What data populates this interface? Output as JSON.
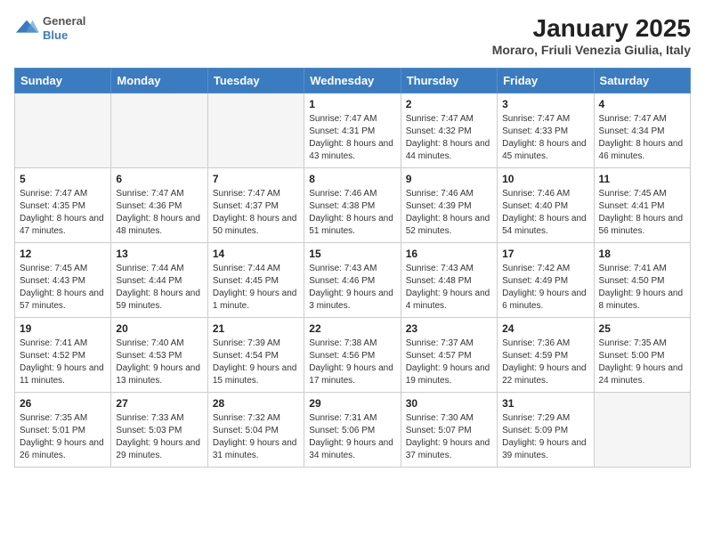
{
  "header": {
    "logo_text_top": "General",
    "logo_text_bottom": "Blue",
    "title": "January 2025",
    "subtitle": "Moraro, Friuli Venezia Giulia, Italy"
  },
  "weekdays": [
    "Sunday",
    "Monday",
    "Tuesday",
    "Wednesday",
    "Thursday",
    "Friday",
    "Saturday"
  ],
  "weeks": [
    [
      {
        "day": "",
        "sunrise": "",
        "sunset": "",
        "daylight": ""
      },
      {
        "day": "",
        "sunrise": "",
        "sunset": "",
        "daylight": ""
      },
      {
        "day": "",
        "sunrise": "",
        "sunset": "",
        "daylight": ""
      },
      {
        "day": "1",
        "sunrise": "Sunrise: 7:47 AM",
        "sunset": "Sunset: 4:31 PM",
        "daylight": "Daylight: 8 hours and 43 minutes."
      },
      {
        "day": "2",
        "sunrise": "Sunrise: 7:47 AM",
        "sunset": "Sunset: 4:32 PM",
        "daylight": "Daylight: 8 hours and 44 minutes."
      },
      {
        "day": "3",
        "sunrise": "Sunrise: 7:47 AM",
        "sunset": "Sunset: 4:33 PM",
        "daylight": "Daylight: 8 hours and 45 minutes."
      },
      {
        "day": "4",
        "sunrise": "Sunrise: 7:47 AM",
        "sunset": "Sunset: 4:34 PM",
        "daylight": "Daylight: 8 hours and 46 minutes."
      }
    ],
    [
      {
        "day": "5",
        "sunrise": "Sunrise: 7:47 AM",
        "sunset": "Sunset: 4:35 PM",
        "daylight": "Daylight: 8 hours and 47 minutes."
      },
      {
        "day": "6",
        "sunrise": "Sunrise: 7:47 AM",
        "sunset": "Sunset: 4:36 PM",
        "daylight": "Daylight: 8 hours and 48 minutes."
      },
      {
        "day": "7",
        "sunrise": "Sunrise: 7:47 AM",
        "sunset": "Sunset: 4:37 PM",
        "daylight": "Daylight: 8 hours and 50 minutes."
      },
      {
        "day": "8",
        "sunrise": "Sunrise: 7:46 AM",
        "sunset": "Sunset: 4:38 PM",
        "daylight": "Daylight: 8 hours and 51 minutes."
      },
      {
        "day": "9",
        "sunrise": "Sunrise: 7:46 AM",
        "sunset": "Sunset: 4:39 PM",
        "daylight": "Daylight: 8 hours and 52 minutes."
      },
      {
        "day": "10",
        "sunrise": "Sunrise: 7:46 AM",
        "sunset": "Sunset: 4:40 PM",
        "daylight": "Daylight: 8 hours and 54 minutes."
      },
      {
        "day": "11",
        "sunrise": "Sunrise: 7:45 AM",
        "sunset": "Sunset: 4:41 PM",
        "daylight": "Daylight: 8 hours and 56 minutes."
      }
    ],
    [
      {
        "day": "12",
        "sunrise": "Sunrise: 7:45 AM",
        "sunset": "Sunset: 4:43 PM",
        "daylight": "Daylight: 8 hours and 57 minutes."
      },
      {
        "day": "13",
        "sunrise": "Sunrise: 7:44 AM",
        "sunset": "Sunset: 4:44 PM",
        "daylight": "Daylight: 8 hours and 59 minutes."
      },
      {
        "day": "14",
        "sunrise": "Sunrise: 7:44 AM",
        "sunset": "Sunset: 4:45 PM",
        "daylight": "Daylight: 9 hours and 1 minute."
      },
      {
        "day": "15",
        "sunrise": "Sunrise: 7:43 AM",
        "sunset": "Sunset: 4:46 PM",
        "daylight": "Daylight: 9 hours and 3 minutes."
      },
      {
        "day": "16",
        "sunrise": "Sunrise: 7:43 AM",
        "sunset": "Sunset: 4:48 PM",
        "daylight": "Daylight: 9 hours and 4 minutes."
      },
      {
        "day": "17",
        "sunrise": "Sunrise: 7:42 AM",
        "sunset": "Sunset: 4:49 PM",
        "daylight": "Daylight: 9 hours and 6 minutes."
      },
      {
        "day": "18",
        "sunrise": "Sunrise: 7:41 AM",
        "sunset": "Sunset: 4:50 PM",
        "daylight": "Daylight: 9 hours and 8 minutes."
      }
    ],
    [
      {
        "day": "19",
        "sunrise": "Sunrise: 7:41 AM",
        "sunset": "Sunset: 4:52 PM",
        "daylight": "Daylight: 9 hours and 11 minutes."
      },
      {
        "day": "20",
        "sunrise": "Sunrise: 7:40 AM",
        "sunset": "Sunset: 4:53 PM",
        "daylight": "Daylight: 9 hours and 13 minutes."
      },
      {
        "day": "21",
        "sunrise": "Sunrise: 7:39 AM",
        "sunset": "Sunset: 4:54 PM",
        "daylight": "Daylight: 9 hours and 15 minutes."
      },
      {
        "day": "22",
        "sunrise": "Sunrise: 7:38 AM",
        "sunset": "Sunset: 4:56 PM",
        "daylight": "Daylight: 9 hours and 17 minutes."
      },
      {
        "day": "23",
        "sunrise": "Sunrise: 7:37 AM",
        "sunset": "Sunset: 4:57 PM",
        "daylight": "Daylight: 9 hours and 19 minutes."
      },
      {
        "day": "24",
        "sunrise": "Sunrise: 7:36 AM",
        "sunset": "Sunset: 4:59 PM",
        "daylight": "Daylight: 9 hours and 22 minutes."
      },
      {
        "day": "25",
        "sunrise": "Sunrise: 7:35 AM",
        "sunset": "Sunset: 5:00 PM",
        "daylight": "Daylight: 9 hours and 24 minutes."
      }
    ],
    [
      {
        "day": "26",
        "sunrise": "Sunrise: 7:35 AM",
        "sunset": "Sunset: 5:01 PM",
        "daylight": "Daylight: 9 hours and 26 minutes."
      },
      {
        "day": "27",
        "sunrise": "Sunrise: 7:33 AM",
        "sunset": "Sunset: 5:03 PM",
        "daylight": "Daylight: 9 hours and 29 minutes."
      },
      {
        "day": "28",
        "sunrise": "Sunrise: 7:32 AM",
        "sunset": "Sunset: 5:04 PM",
        "daylight": "Daylight: 9 hours and 31 minutes."
      },
      {
        "day": "29",
        "sunrise": "Sunrise: 7:31 AM",
        "sunset": "Sunset: 5:06 PM",
        "daylight": "Daylight: 9 hours and 34 minutes."
      },
      {
        "day": "30",
        "sunrise": "Sunrise: 7:30 AM",
        "sunset": "Sunset: 5:07 PM",
        "daylight": "Daylight: 9 hours and 37 minutes."
      },
      {
        "day": "31",
        "sunrise": "Sunrise: 7:29 AM",
        "sunset": "Sunset: 5:09 PM",
        "daylight": "Daylight: 9 hours and 39 minutes."
      },
      {
        "day": "",
        "sunrise": "",
        "sunset": "",
        "daylight": ""
      }
    ]
  ]
}
